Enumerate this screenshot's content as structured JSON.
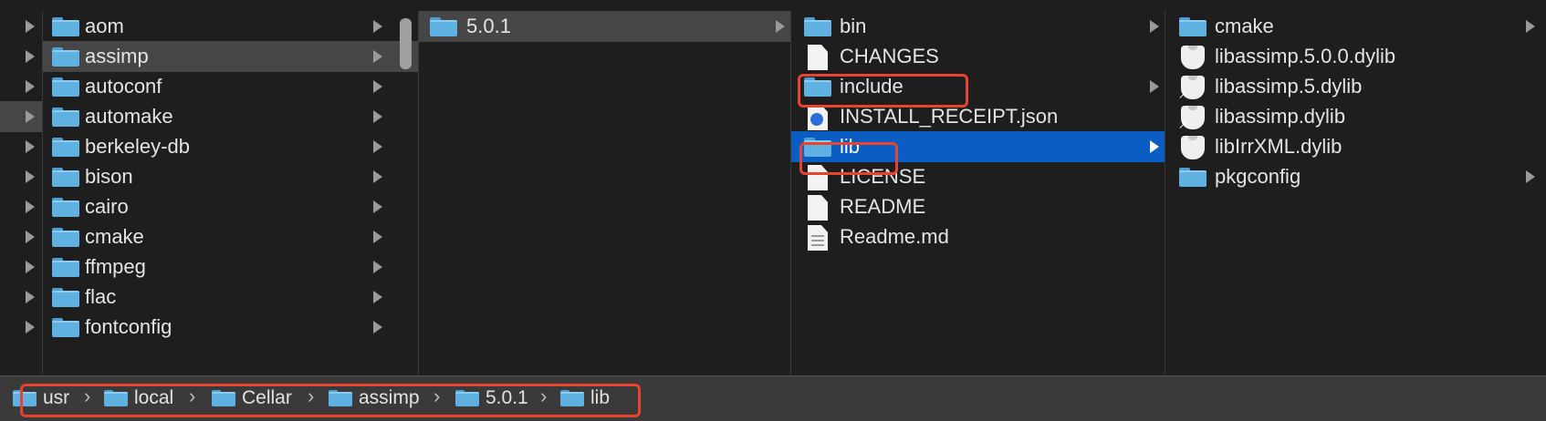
{
  "columns": {
    "c1": {
      "items": [
        {
          "label": "aom",
          "selected": false
        },
        {
          "label": "assimp",
          "selected": true
        },
        {
          "label": "autoconf",
          "selected": false
        },
        {
          "label": "automake",
          "selected": false
        },
        {
          "label": "berkeley-db",
          "selected": false
        },
        {
          "label": "bison",
          "selected": false
        },
        {
          "label": "cairo",
          "selected": false
        },
        {
          "label": "cmake",
          "selected": false
        },
        {
          "label": "ffmpeg",
          "selected": false
        },
        {
          "label": "flac",
          "selected": false
        },
        {
          "label": "fontconfig",
          "selected": false
        }
      ]
    },
    "c2": {
      "items": [
        {
          "label": "5.0.1",
          "selected": true
        }
      ]
    },
    "c3": {
      "items": [
        {
          "label": "bin"
        },
        {
          "label": "CHANGES"
        },
        {
          "label": "include"
        },
        {
          "label": "INSTALL_RECEIPT.json"
        },
        {
          "label": "lib",
          "selected": true
        },
        {
          "label": "LICENSE"
        },
        {
          "label": "README"
        },
        {
          "label": "Readme.md"
        }
      ]
    },
    "c4": {
      "items": [
        {
          "label": "cmake"
        },
        {
          "label": "libassimp.5.0.0.dylib"
        },
        {
          "label": "libassimp.5.dylib",
          "alias": true
        },
        {
          "label": "libassimp.dylib",
          "alias": true
        },
        {
          "label": "libIrrXML.dylib"
        },
        {
          "label": "pkgconfig"
        }
      ]
    }
  },
  "pathbar": {
    "crumbs": [
      "usr",
      "local",
      "Cellar",
      "assimp",
      "5.0.1",
      "lib"
    ]
  },
  "colors": {
    "selection_blue": "#0a5dc2",
    "selection_gray": "#464646",
    "highlight_red": "#e8432e",
    "folder_blue": "#5fb1e2"
  },
  "icons": {
    "folder": "folder-icon",
    "document": "document-icon",
    "json": "json-file-icon",
    "markdown": "markdown-file-icon",
    "library": "library-file-icon",
    "chevron": "chevron-right-icon",
    "alias": "alias-arrow-icon"
  }
}
